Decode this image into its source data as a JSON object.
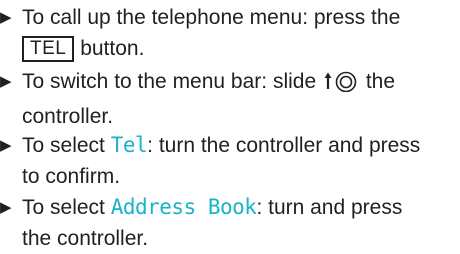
{
  "steps": [
    {
      "line1": "To call up the telephone menu: press the",
      "key_label": "TEL",
      "line2_after": " button."
    },
    {
      "line1_before": "To switch to the menu bar: slide ",
      "line1_after": " the",
      "line2": "controller."
    },
    {
      "line1_before": "To select ",
      "menu_term": "Tel",
      "line1_after": ": turn the controller and press",
      "line2": "to confirm."
    },
    {
      "line1_before": "To select ",
      "menu_term": "Address Book",
      "line1_after": ": turn and press",
      "line2": "the controller."
    }
  ],
  "bullet_glyph": "▶",
  "colors": {
    "text": "#231f20",
    "menu_term": "#1ab3c8"
  },
  "icons": {
    "controller_slide": "controller-slide-up-icon"
  }
}
